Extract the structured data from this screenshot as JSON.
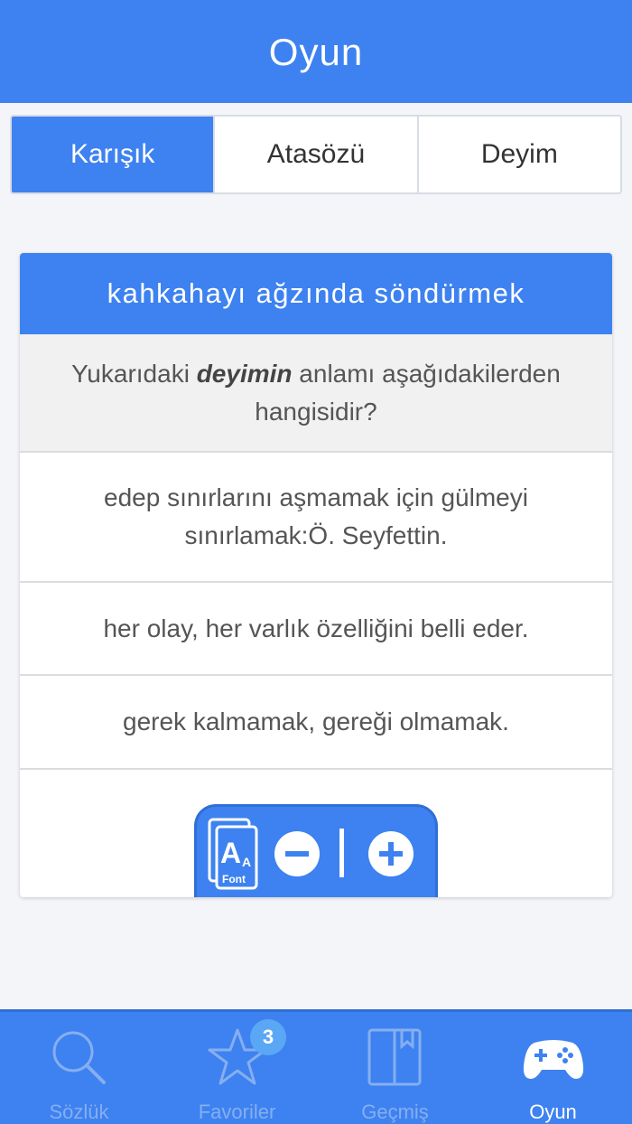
{
  "header": {
    "title": "Oyun"
  },
  "segments": [
    {
      "label": "Karışık",
      "active": true
    },
    {
      "label": "Atasözü",
      "active": false
    },
    {
      "label": "Deyim",
      "active": false
    }
  ],
  "card": {
    "phrase": "kahkahayı ağzında söndürmek",
    "question": {
      "prefix": "Yukarıdaki",
      "emphasis": "deyimin",
      "suffix": "anlamı aşağıdakilerden hangisidir?"
    },
    "options": [
      "edep sınırlarını aşmamak için gülmeyi sınırlamak:Ö. Seyfettin.",
      "her olay, her varlık özelliğini belli eder.",
      "gerek kalmamak, gereği olmamak."
    ]
  },
  "font_control": {
    "icon": "font-size-icon",
    "icon_label": "Font",
    "icon_letter": "A",
    "icon_small_letter": "A"
  },
  "tabbar": {
    "items": [
      {
        "label": "Sözlük",
        "icon": "search-icon",
        "active": false
      },
      {
        "label": "Favoriler",
        "icon": "star-icon",
        "active": false,
        "badge": "3"
      },
      {
        "label": "Geçmiş",
        "icon": "book-icon",
        "active": false
      },
      {
        "label": "Oyun",
        "icon": "gamepad-icon",
        "active": true
      }
    ]
  },
  "colors": {
    "primary": "#3d82f0",
    "tab_inactive": "#86aef0",
    "badge": "#5aa7f5"
  }
}
